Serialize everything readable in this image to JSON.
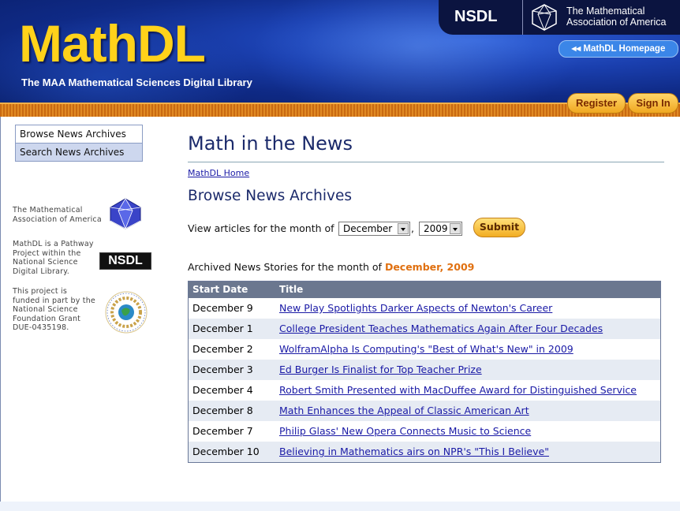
{
  "header": {
    "logo": "MathDL",
    "tagline": "The MAA Mathematical Sciences Digital Library",
    "nsdl": "NSDL",
    "maa_line1": "The Mathematical",
    "maa_line2": "Association of America",
    "home_button": "◂◂ MathDL Homepage",
    "register": "Register",
    "sign_in": "Sign In"
  },
  "sidebar": {
    "items": [
      {
        "label": "Browse News Archives"
      },
      {
        "label": "Search News Archives"
      }
    ],
    "maa_line1": "The Mathematical",
    "maa_line2": "Association of America",
    "pathway_lines": [
      "MathDL is a Pathway",
      "Project within the",
      "National Science",
      "Digital Library."
    ],
    "nsdl_logo": "NSDL",
    "funding_lines": [
      "This project is",
      "funded in part by the",
      "National Science",
      "Foundation Grant",
      "DUE-0435198."
    ]
  },
  "main": {
    "title": "Math in the News",
    "breadcrumb": "MathDL Home",
    "section_title": "Browse News Archives",
    "view_label": "View articles for the month of",
    "month_select": "December",
    "comma": ",",
    "year_select": "2009",
    "submit": "Submit",
    "archived_prefix": "Archived News Stories for the month of",
    "archived_month": "December, 2009",
    "table": {
      "headers": [
        "Start Date",
        "Title"
      ],
      "rows": [
        {
          "date": "December 9",
          "title": "New Play Spotlights Darker Aspects of Newton's Career"
        },
        {
          "date": "December 1",
          "title": "College President Teaches Mathematics Again After Four Decades"
        },
        {
          "date": "December 2",
          "title": "WolframAlpha Is Computing's \"Best of What's New\" in 2009"
        },
        {
          "date": "December 3",
          "title": "Ed Burger Is Finalist for Top Teacher Prize"
        },
        {
          "date": "December 4",
          "title": "Robert Smith Presented with MacDuffee Award for Distinguished Service"
        },
        {
          "date": "December 8",
          "title": "Math Enhances the Appeal of Classic American Art"
        },
        {
          "date": "December 7",
          "title": "Philip Glass' New Opera Connects Music to Science"
        },
        {
          "date": "December 10",
          "title": "Believing in Mathematics airs on NPR's \"This I Believe\""
        }
      ]
    }
  },
  "colors": {
    "header_blue": "#1a3fae",
    "logo_yellow": "#ffd21a",
    "title_navy": "#1b2a6b",
    "link_blue": "#1a1aa6",
    "highlight_orange": "#e07010"
  }
}
